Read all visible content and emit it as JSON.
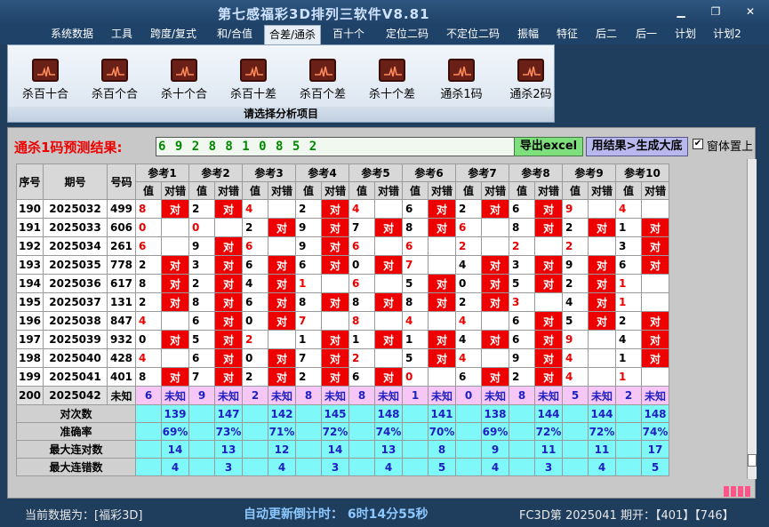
{
  "app": {
    "title": "第七感福彩3D排列三软件V8.81"
  },
  "window_buttons": [
    {
      "name": "minimize-button",
      "glyph": "▁"
    },
    {
      "name": "restore-button",
      "glyph": "❐"
    },
    {
      "name": "close-button",
      "glyph": "✕"
    }
  ],
  "menu": [
    "系统数据",
    "工具",
    "跨度/复式",
    "和/合值",
    "合差/通杀",
    "百十个",
    "定位二码",
    "不定位二码",
    "振幅",
    "特征",
    "后二",
    "后一",
    "计划",
    "计划2"
  ],
  "menu_active": 4,
  "ribbon": {
    "buttons": [
      "杀百十合",
      "杀百个合",
      "杀十个合",
      "杀百十差",
      "杀百个差",
      "杀十个差",
      "通杀1码",
      "通杀2码"
    ],
    "footer": "请选择分析项目"
  },
  "prediction": {
    "label": "通杀1码预测结果:",
    "value": "6 9 2 8 8 1 0 8 5 2",
    "export_label": "导出excel",
    "generate_label": "用结果>生成大底",
    "on_top_label": "窗体置上",
    "on_top_checked": "✔"
  },
  "table": {
    "headers": {
      "seq": "序号",
      "period": "期号",
      "number": "号码",
      "refs": [
        "参考1",
        "参考2",
        "参考3",
        "参考4",
        "参考5",
        "参考6",
        "参考7",
        "参考8",
        "参考9",
        "参考10"
      ],
      "val": "值",
      "hit": "对错"
    },
    "hit_label": "对",
    "rows": [
      {
        "seq": "190",
        "period": "2025032",
        "number": "499",
        "vals": [
          [
            "8",
            "r",
            1
          ],
          [
            "2",
            "b",
            1
          ],
          [
            "4",
            "r",
            0
          ],
          [
            "2",
            "b",
            1
          ],
          [
            "4",
            "r",
            0
          ],
          [
            "6",
            "b",
            1
          ],
          [
            "2",
            "b",
            1
          ],
          [
            "6",
            "b",
            1
          ],
          [
            "9",
            "r",
            0
          ],
          [
            "4",
            "r",
            0
          ]
        ]
      },
      {
        "seq": "191",
        "period": "2025033",
        "number": "606",
        "vals": [
          [
            "0",
            "r",
            0
          ],
          [
            "0",
            "r",
            0
          ],
          [
            "2",
            "b",
            1
          ],
          [
            "9",
            "b",
            1
          ],
          [
            "7",
            "b",
            1
          ],
          [
            "8",
            "b",
            1
          ],
          [
            "6",
            "r",
            0
          ],
          [
            "8",
            "b",
            1
          ],
          [
            "2",
            "b",
            1
          ],
          [
            "1",
            "b",
            1
          ]
        ]
      },
      {
        "seq": "192",
        "period": "2025034",
        "number": "261",
        "vals": [
          [
            "6",
            "r",
            0
          ],
          [
            "9",
            "b",
            1
          ],
          [
            "6",
            "r",
            0
          ],
          [
            "9",
            "b",
            1
          ],
          [
            "6",
            "r",
            0
          ],
          [
            "6",
            "r",
            0
          ],
          [
            "2",
            "r",
            0
          ],
          [
            "2",
            "r",
            0
          ],
          [
            "2",
            "r",
            0
          ],
          [
            "3",
            "b",
            1
          ]
        ]
      },
      {
        "seq": "193",
        "period": "2025035",
        "number": "778",
        "vals": [
          [
            "2",
            "b",
            1
          ],
          [
            "3",
            "b",
            1
          ],
          [
            "6",
            "b",
            1
          ],
          [
            "6",
            "b",
            1
          ],
          [
            "0",
            "b",
            1
          ],
          [
            "7",
            "r",
            0
          ],
          [
            "4",
            "b",
            1
          ],
          [
            "3",
            "b",
            1
          ],
          [
            "9",
            "b",
            1
          ],
          [
            "6",
            "b",
            1
          ]
        ]
      },
      {
        "seq": "194",
        "period": "2025036",
        "number": "617",
        "vals": [
          [
            "8",
            "b",
            1
          ],
          [
            "2",
            "b",
            1
          ],
          [
            "4",
            "b",
            1
          ],
          [
            "1",
            "r",
            0
          ],
          [
            "6",
            "r",
            0
          ],
          [
            "5",
            "b",
            1
          ],
          [
            "0",
            "b",
            1
          ],
          [
            "5",
            "b",
            1
          ],
          [
            "2",
            "b",
            1
          ],
          [
            "1",
            "r",
            0
          ]
        ]
      },
      {
        "seq": "195",
        "period": "2025037",
        "number": "131",
        "vals": [
          [
            "2",
            "b",
            1
          ],
          [
            "8",
            "b",
            1
          ],
          [
            "6",
            "b",
            1
          ],
          [
            "8",
            "b",
            1
          ],
          [
            "8",
            "b",
            1
          ],
          [
            "8",
            "b",
            1
          ],
          [
            "2",
            "b",
            1
          ],
          [
            "3",
            "r",
            0
          ],
          [
            "4",
            "b",
            1
          ],
          [
            "1",
            "r",
            0
          ]
        ]
      },
      {
        "seq": "196",
        "period": "2025038",
        "number": "847",
        "vals": [
          [
            "4",
            "r",
            0
          ],
          [
            "6",
            "b",
            1
          ],
          [
            "0",
            "b",
            1
          ],
          [
            "7",
            "r",
            0
          ],
          [
            "8",
            "r",
            0
          ],
          [
            "4",
            "r",
            0
          ],
          [
            "4",
            "r",
            0
          ],
          [
            "6",
            "b",
            1
          ],
          [
            "5",
            "b",
            1
          ],
          [
            "2",
            "b",
            1
          ]
        ]
      },
      {
        "seq": "197",
        "period": "2025039",
        "number": "932",
        "vals": [
          [
            "0",
            "b",
            1
          ],
          [
            "5",
            "b",
            1
          ],
          [
            "2",
            "r",
            0
          ],
          [
            "1",
            "b",
            1
          ],
          [
            "1",
            "b",
            1
          ],
          [
            "1",
            "b",
            1
          ],
          [
            "4",
            "b",
            1
          ],
          [
            "6",
            "b",
            1
          ],
          [
            "9",
            "r",
            0
          ],
          [
            "4",
            "b",
            1
          ]
        ]
      },
      {
        "seq": "198",
        "period": "2025040",
        "number": "428",
        "vals": [
          [
            "4",
            "r",
            0
          ],
          [
            "6",
            "b",
            1
          ],
          [
            "0",
            "b",
            1
          ],
          [
            "7",
            "b",
            1
          ],
          [
            "2",
            "r",
            0
          ],
          [
            "5",
            "b",
            1
          ],
          [
            "4",
            "r",
            0
          ],
          [
            "9",
            "b",
            1
          ],
          [
            "4",
            "r",
            0
          ],
          [
            "1",
            "b",
            1
          ]
        ]
      },
      {
        "seq": "199",
        "period": "2025041",
        "number": "401",
        "vals": [
          [
            "8",
            "b",
            1
          ],
          [
            "7",
            "b",
            1
          ],
          [
            "2",
            "b",
            1
          ],
          [
            "2",
            "b",
            1
          ],
          [
            "6",
            "b",
            1
          ],
          [
            "0",
            "r",
            0
          ],
          [
            "6",
            "b",
            1
          ],
          [
            "2",
            "b",
            1
          ],
          [
            "4",
            "r",
            0
          ],
          [
            "1",
            "r",
            0
          ]
        ]
      }
    ],
    "pred_row": {
      "seq": "200",
      "period": "2025042",
      "number": "未知",
      "vals": [
        "6",
        "9",
        "2",
        "8",
        "8",
        "1",
        "0",
        "8",
        "5",
        "2"
      ],
      "hit": "未知"
    },
    "stats": [
      {
        "label": "对次数",
        "vals": [
          "139",
          "147",
          "142",
          "145",
          "148",
          "141",
          "138",
          "144",
          "144",
          "148"
        ]
      },
      {
        "label": "准确率",
        "vals": [
          "69%",
          "73%",
          "71%",
          "72%",
          "74%",
          "70%",
          "69%",
          "72%",
          "72%",
          "74%"
        ]
      },
      {
        "label": "最大连对数",
        "vals": [
          "14",
          "13",
          "12",
          "14",
          "13",
          "8",
          "9",
          "11",
          "11",
          "17"
        ]
      },
      {
        "label": "最大连错数",
        "vals": [
          "4",
          "3",
          "4",
          "3",
          "4",
          "5",
          "4",
          "3",
          "4",
          "5"
        ]
      }
    ]
  },
  "status": {
    "left": "当前数据为：[福彩3D]",
    "countdown": "自动更新倒计时： 6时14分55秒",
    "right": "FC3D第 2025041 期开：【401】【746】"
  }
}
